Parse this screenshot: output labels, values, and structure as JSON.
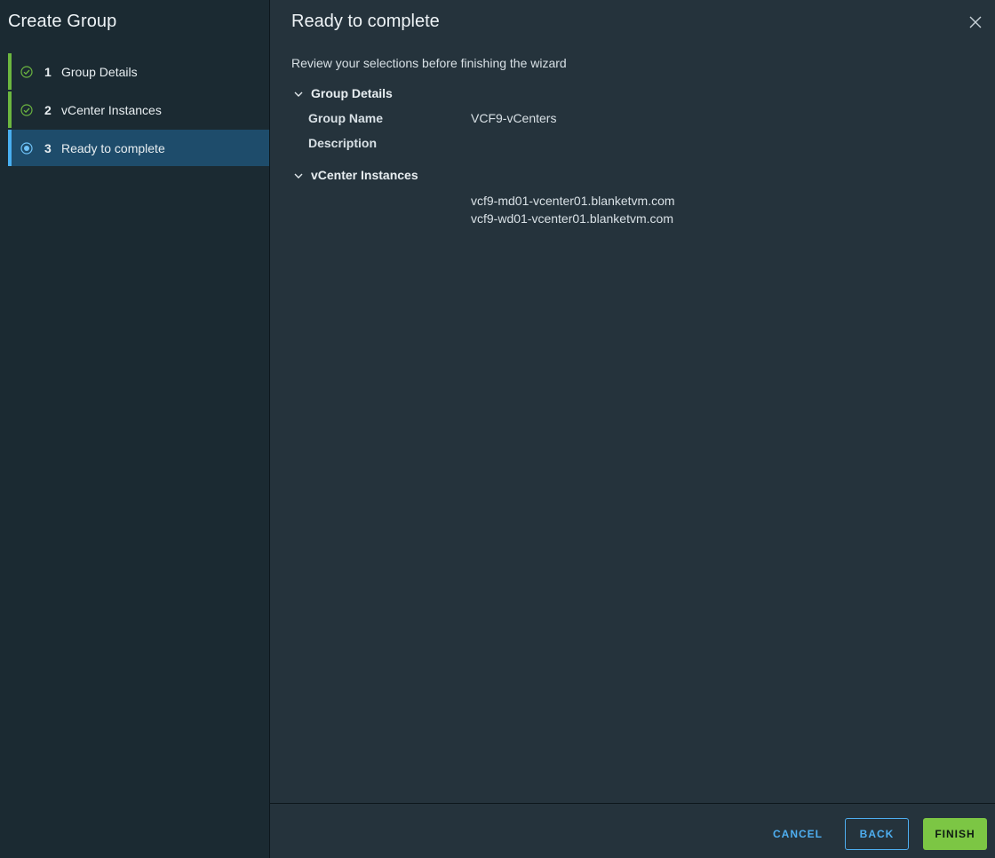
{
  "sidebar": {
    "title": "Create Group",
    "steps": [
      {
        "number": "1",
        "label": "Group Details",
        "status": "complete"
      },
      {
        "number": "2",
        "label": "vCenter Instances",
        "status": "complete"
      },
      {
        "number": "3",
        "label": "Ready to complete",
        "status": "active"
      }
    ]
  },
  "main": {
    "title": "Ready to complete",
    "subtitle": "Review your selections before finishing the wizard",
    "group_details": {
      "heading": "Group Details",
      "name_label": "Group Name",
      "name_value": "VCF9-vCenters",
      "description_label": "Description",
      "description_value": ""
    },
    "vcenter_instances": {
      "heading": "vCenter Instances",
      "items": [
        "vcf9-md01-vcenter01.blanketvm.com",
        "vcf9-wd01-vcenter01.blanketvm.com"
      ]
    }
  },
  "footer": {
    "cancel_label": "CANCEL",
    "back_label": "BACK",
    "finish_label": "FINISH"
  },
  "colors": {
    "complete_accent": "#6cb640",
    "active_accent": "#49aff0",
    "link_blue": "#4eaef0",
    "finish_green": "#7cc644",
    "sidebar_bg": "#1b2a32",
    "main_bg": "#25333c"
  },
  "icons": {
    "complete": "check-circle-icon",
    "active": "dot-circle-icon",
    "close": "close-icon",
    "expand": "chevron-down-icon"
  }
}
